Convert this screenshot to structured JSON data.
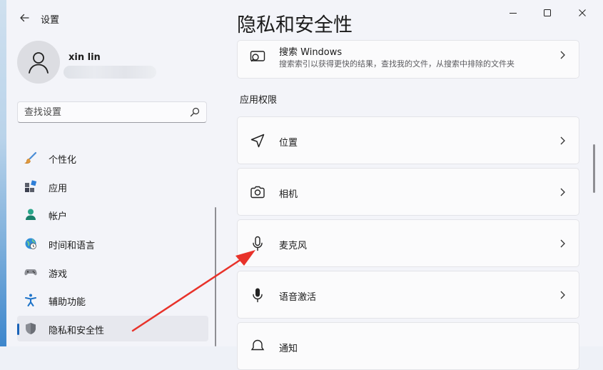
{
  "window": {
    "app_title": "设置"
  },
  "profile": {
    "name": "xin lin"
  },
  "search": {
    "placeholder": "查找设置"
  },
  "nav": {
    "items": [
      {
        "label": "个性化"
      },
      {
        "label": "应用"
      },
      {
        "label": "帐户"
      },
      {
        "label": "时间和语言"
      },
      {
        "label": "游戏"
      },
      {
        "label": "辅助功能"
      },
      {
        "label": "隐私和安全性",
        "active": true
      }
    ]
  },
  "page": {
    "title": "隐私和安全性"
  },
  "top_card": {
    "title": "搜索 Windows",
    "subtitle": "搜索索引以获得更快的结果，查找我的文件，从搜索中排除的文件夹"
  },
  "app_permissions": {
    "section_label": "应用权限",
    "items": [
      {
        "label": "位置",
        "icon": "location-icon"
      },
      {
        "label": "相机",
        "icon": "camera-icon"
      },
      {
        "label": "麦克风",
        "icon": "microphone-icon"
      },
      {
        "label": "语音激活",
        "icon": "voice-activation-icon"
      },
      {
        "label": "通知",
        "icon": "notification-icon"
      }
    ]
  },
  "colors": {
    "accent": "#1a63b8",
    "annotation_arrow": "#e8322a"
  }
}
